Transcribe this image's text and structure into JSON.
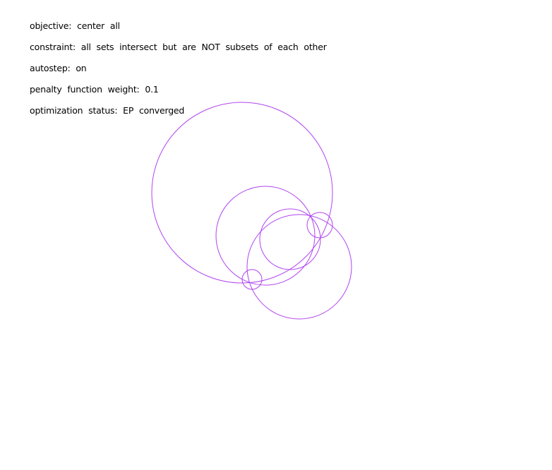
{
  "status": {
    "objective": "objective: center all",
    "constraint": "constraint: all sets intersect but are NOT subsets of each other",
    "autostep": "autostep: on",
    "penalty": "penalty function weight: 0.1",
    "optimization": "optimization status: EP converged"
  },
  "style": {
    "circle_color": "#b044f0",
    "text_color": "#000000",
    "background": "#ffffff"
  }
}
